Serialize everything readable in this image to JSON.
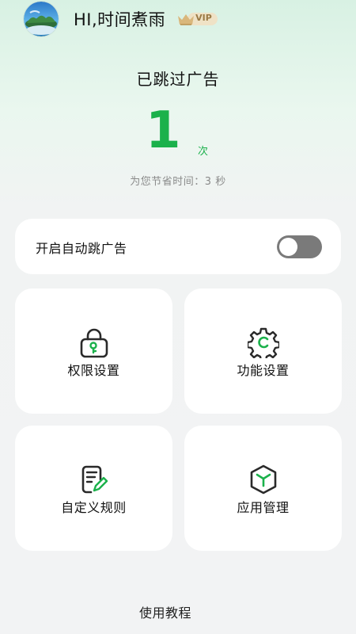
{
  "header": {
    "greeting": "HI,时间煮雨",
    "vip_label": "VIP"
  },
  "stats": {
    "title": "已跳过广告",
    "count": "1",
    "unit": "次",
    "saved_time": "为您节省时间：3 秒"
  },
  "auto_skip": {
    "label": "开启自动跳广告",
    "enabled": false
  },
  "tiles": [
    {
      "label": "权限设置",
      "icon": "lock-key-icon"
    },
    {
      "label": "功能设置",
      "icon": "gear-icon"
    },
    {
      "label": "自定义规则",
      "icon": "document-edit-icon"
    },
    {
      "label": "应用管理",
      "icon": "cube-icon"
    }
  ],
  "footer": {
    "tutorial_label": "使用教程"
  },
  "colors": {
    "accent_green": "#1bb14b",
    "icon_dark": "#2a2a2a",
    "toggle_off": "#7a7a7a"
  }
}
